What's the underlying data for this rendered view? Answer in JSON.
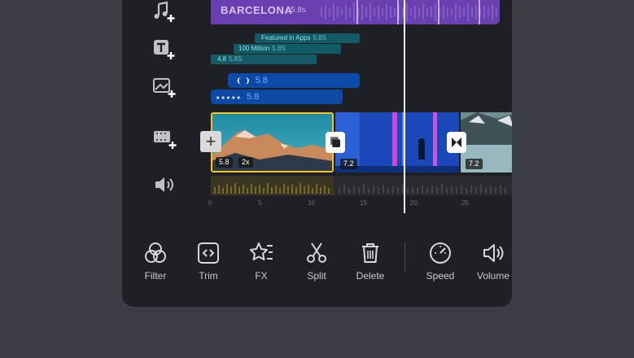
{
  "side_tools": [
    {
      "name": "add-music-button",
      "icon": "music-note-plus-icon"
    },
    {
      "name": "add-text-button",
      "icon": "text-plus-icon"
    },
    {
      "name": "add-sticker-button",
      "icon": "image-plus-icon"
    },
    {
      "name": "add-clip-button",
      "icon": "film-plus-icon"
    },
    {
      "name": "audio-button",
      "icon": "speaker-icon"
    }
  ],
  "music_track": {
    "title": "BARCELONA",
    "duration": "5.8s",
    "color": "#6a3fb0"
  },
  "text_tracks": [
    {
      "label": "Featured in Apps",
      "value": "5.8S"
    },
    {
      "label": "100 Million",
      "value": "5.8S"
    },
    {
      "label": "4.8",
      "value": "5.8S"
    }
  ],
  "sticker_tracks": [
    {
      "icon": "laurel-icon",
      "value": "5.8"
    },
    {
      "icon": "stars-icon",
      "value": "5.8"
    }
  ],
  "clips": [
    {
      "duration": "5.8",
      "speed": "2x"
    },
    {
      "duration": "7.2"
    },
    {
      "duration": "7.2"
    }
  ],
  "ruler_ticks": [
    "0",
    "5",
    "10",
    "15",
    "20",
    "25"
  ],
  "add_button": "+",
  "toolbar": [
    {
      "label": "Filter",
      "icon": "filter-icon"
    },
    {
      "label": "Trim",
      "icon": "trim-icon"
    },
    {
      "label": "FX",
      "icon": "fx-icon"
    },
    {
      "label": "Split",
      "icon": "scissors-icon"
    },
    {
      "label": "Delete",
      "icon": "trash-icon"
    },
    {
      "label": "Speed",
      "icon": "speed-icon"
    },
    {
      "label": "Volume",
      "icon": "volume-icon"
    }
  ],
  "colors": {
    "selection": "#f5c518",
    "sticker": "#0d4aa8",
    "text_track": "#115a66",
    "playhead": "#ffffff"
  }
}
